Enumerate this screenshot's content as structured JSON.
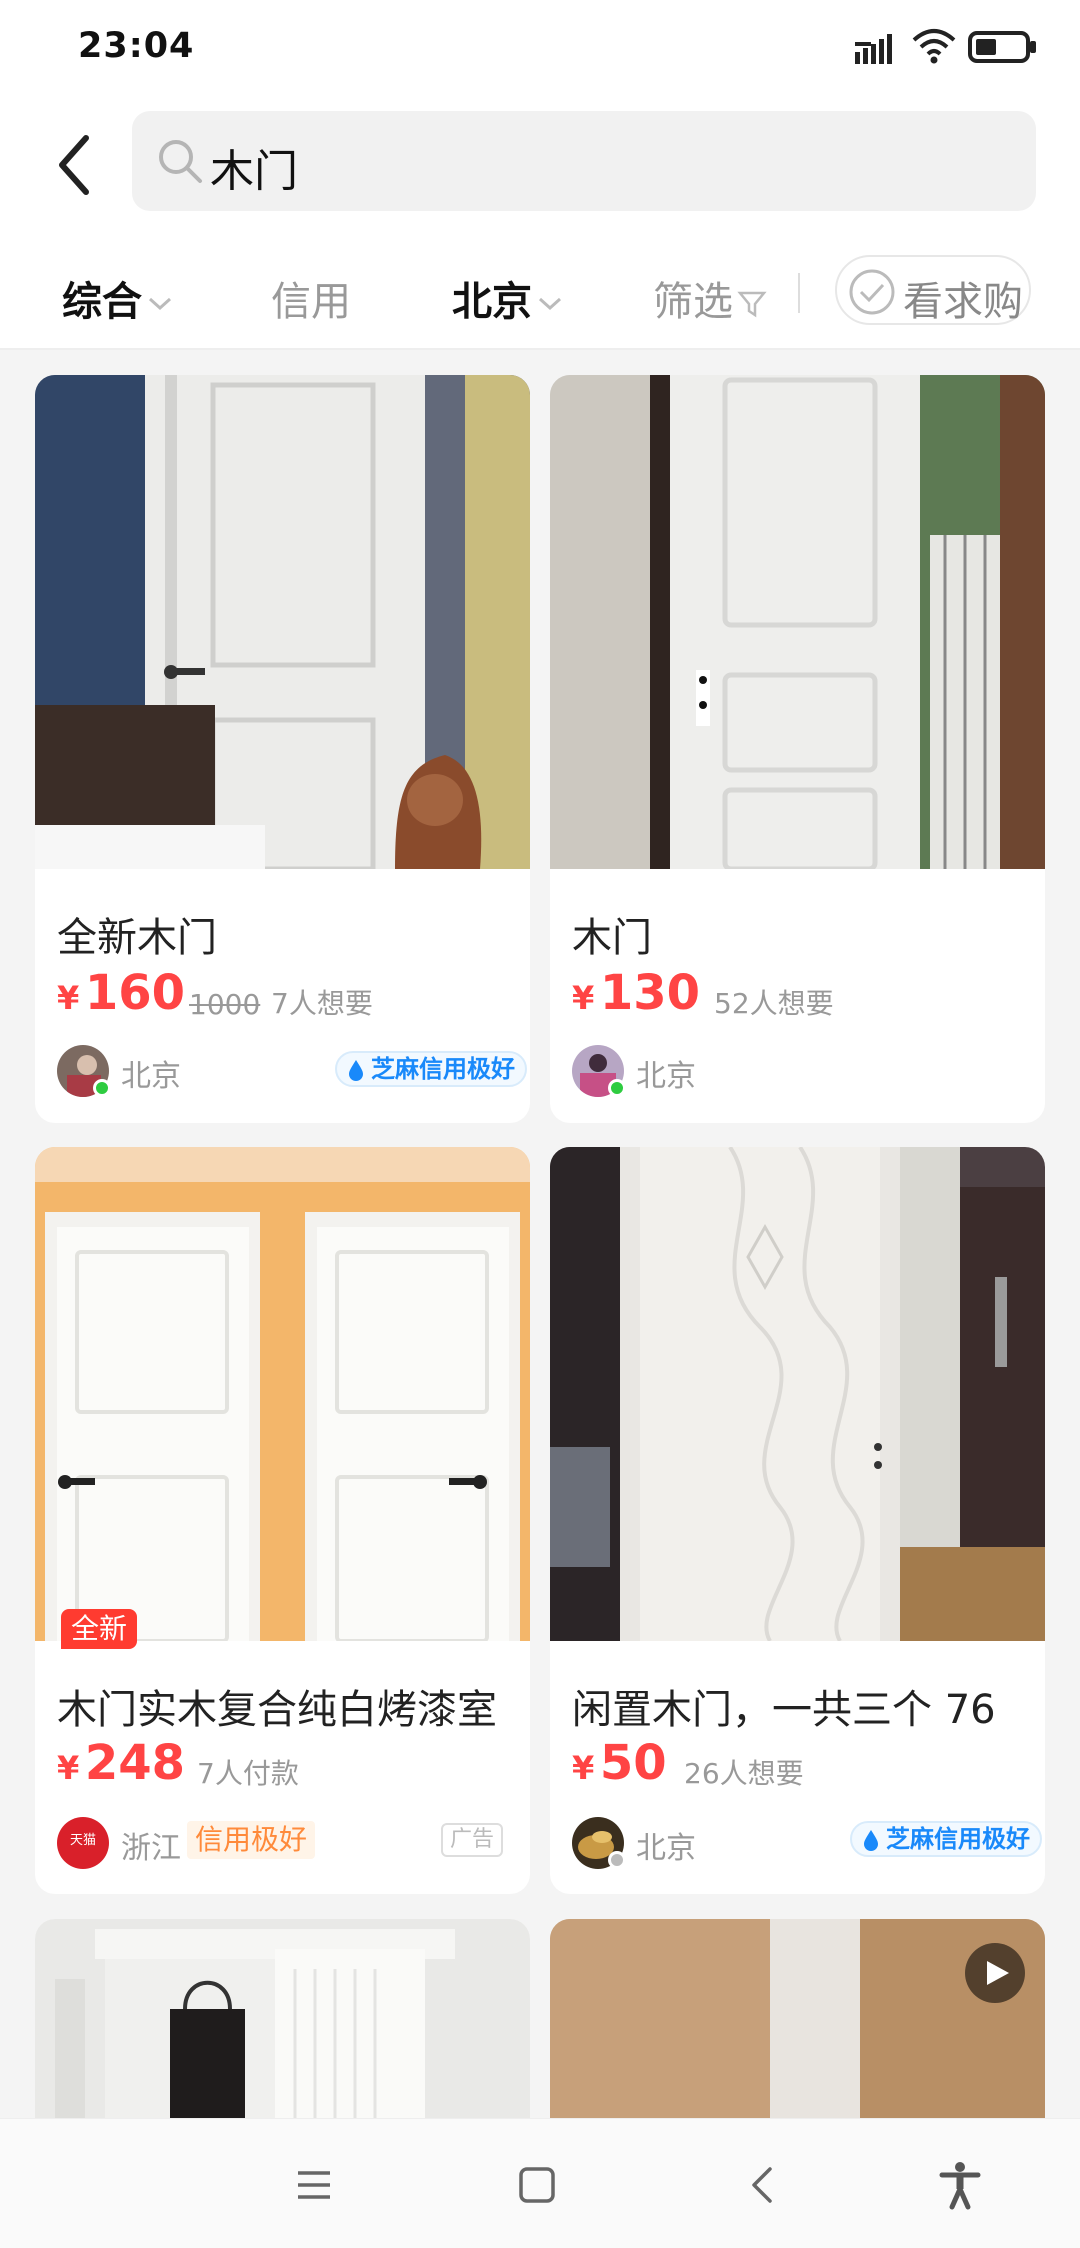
{
  "status_bar": {
    "time": "23:04"
  },
  "search": {
    "query": "木门"
  },
  "filters": [
    {
      "label": "综合",
      "active": true
    },
    {
      "label": "信用",
      "active": false
    },
    {
      "label": "北京",
      "active": true
    },
    {
      "label": "筛选",
      "active": false
    }
  ],
  "want_to_buy_label": "看求购",
  "listings": [
    {
      "title": "全新木门",
      "currency": "¥",
      "price": "160",
      "original_price": "1000",
      "meta": "7人想要",
      "location": "北京",
      "badge": "芝麻信用极好"
    },
    {
      "title": "木门",
      "currency": "¥",
      "price": "130",
      "meta": "52人想要",
      "location": "北京"
    },
    {
      "title": "木门实木复合纯白烤漆室",
      "currency": "¥",
      "price": "248",
      "meta": "7人付款",
      "location": "浙江",
      "credit_tag": "信用极好",
      "ad_label": "广告",
      "new_tag": "全新",
      "avatar_text": "天猫"
    },
    {
      "title": "闲置木门，一共三个 76",
      "currency": "¥",
      "price": "50",
      "meta": "26人想要",
      "location": "北京",
      "badge": "芝麻信用极好"
    }
  ],
  "colors": {
    "price": "#ff4444",
    "badge_blue": "#1989fa",
    "online_green": "#2ecc40"
  }
}
